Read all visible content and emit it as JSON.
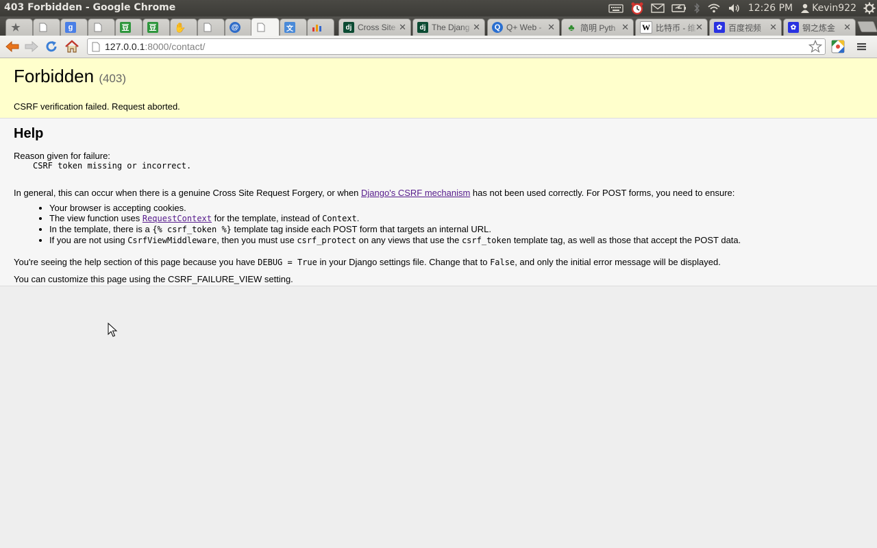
{
  "window": {
    "title": "403 Forbidden - Google Chrome",
    "clock": "12:26 PM",
    "user": "Kevin922"
  },
  "tabs": [
    {
      "label": "",
      "icon": "bookmark-star-icon"
    },
    {
      "label": "",
      "icon": "blank-page-icon"
    },
    {
      "label": "",
      "icon": "google-icon"
    },
    {
      "label": "",
      "icon": "blank-page-icon"
    },
    {
      "label": "",
      "icon": "douban-icon"
    },
    {
      "label": "",
      "icon": "douban-icon"
    },
    {
      "label": "",
      "icon": "hand-icon"
    },
    {
      "label": "",
      "icon": "blank-page-icon"
    },
    {
      "label": "",
      "icon": "at-icon"
    },
    {
      "label": "",
      "icon": "blank-page-icon",
      "active": true
    },
    {
      "label": "",
      "icon": "translate-icon"
    },
    {
      "label": "",
      "icon": "chart-icon"
    },
    {
      "label": "Cross Site",
      "icon": "django-icon"
    },
    {
      "label": "The Djang",
      "icon": "django-icon"
    },
    {
      "label": "Q+ Web -",
      "icon": "qplus-icon"
    },
    {
      "label": "简明 Pyth",
      "icon": "leaf-icon"
    },
    {
      "label": "比特币 - 维",
      "icon": "wikipedia-icon"
    },
    {
      "label": "百度视频",
      "icon": "baidu-icon"
    },
    {
      "label": "钢之炼金",
      "icon": "baidu-icon"
    }
  ],
  "address": {
    "host": "127.0.0.1",
    "rest": ":8000/contact/"
  },
  "summary": {
    "title": "Forbidden",
    "code": "(403)",
    "message": "CSRF verification failed. Request aborted."
  },
  "help": {
    "heading": "Help",
    "reason_label": "Reason given for failure:",
    "reason_text": "CSRF token missing or incorrect.",
    "general_before": "In general, this can occur when there is a genuine Cross Site Request Forgery, or when ",
    "general_link": "Django's CSRF mechanism",
    "general_after": " has not been used correctly. For POST forms, you need to ensure:",
    "b1": "Your browser is accepting cookies.",
    "b2_before": "The view function uses ",
    "b2_link": "RequestContext",
    "b2_mid": " for the template, instead of ",
    "b2_code": "Context",
    "b2_after": ".",
    "b3_before": "In the template, there is a ",
    "b3_code": "{% csrf_token %}",
    "b3_after": " template tag inside each POST form that targets an internal URL.",
    "b4_before": "If you are not using ",
    "b4_code1": "CsrfViewMiddleware",
    "b4_mid1": ", then you must use ",
    "b4_code2": "csrf_protect",
    "b4_mid2": " on any views that use the ",
    "b4_code3": "csrf_token",
    "b4_after": " template tag, as well as those that accept the POST data.",
    "debug_before": "You're seeing the help section of this page because you have ",
    "debug_code1": "DEBUG = True",
    "debug_mid": " in your Django settings file. Change that to ",
    "debug_code2": "False",
    "debug_after": ", and only the initial error message will be displayed.",
    "customize": "You can customize this page using the CSRF_FAILURE_VIEW setting."
  }
}
